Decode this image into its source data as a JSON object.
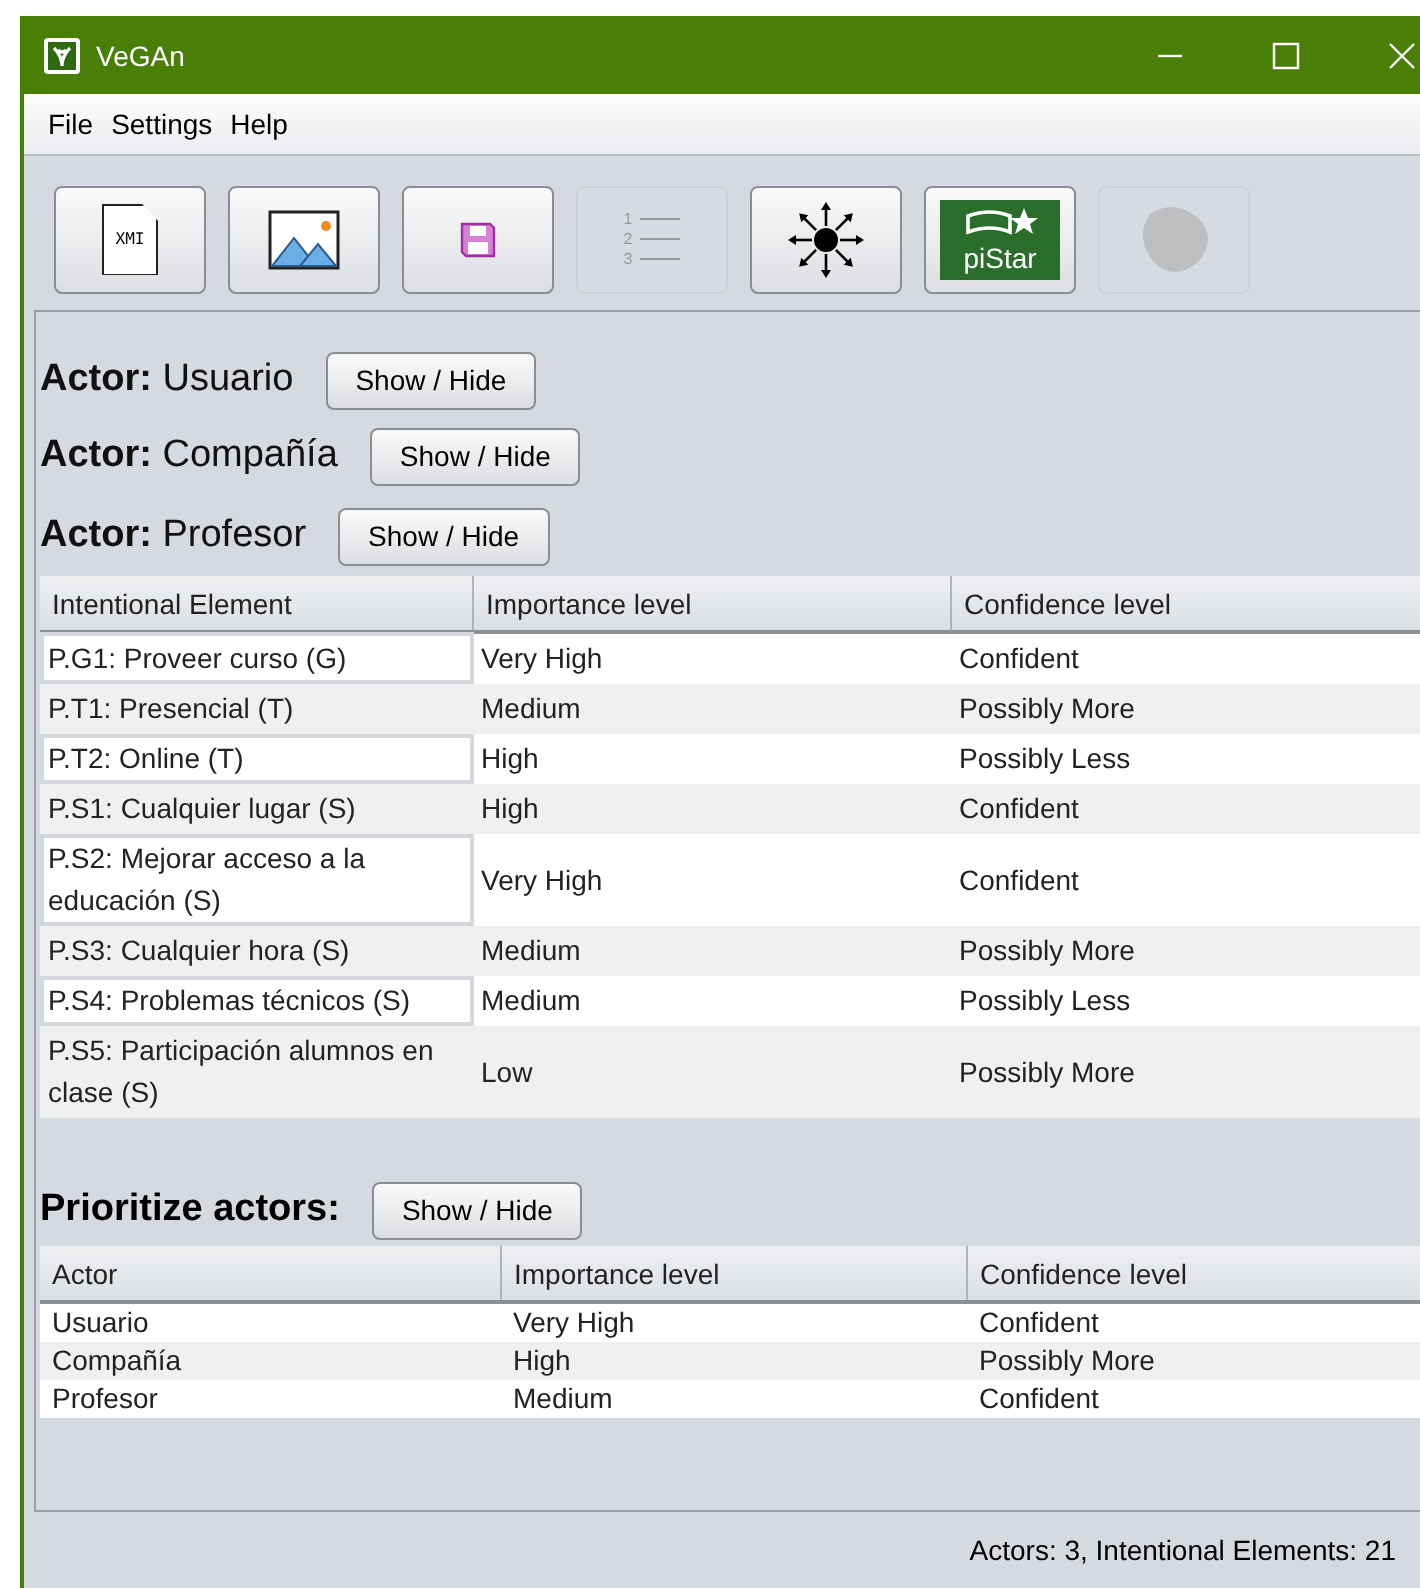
{
  "window": {
    "title": "VeGAn"
  },
  "menu": [
    "File",
    "Settings",
    "Help"
  ],
  "toolbar": [
    {
      "kind": "xmi",
      "disabled": false,
      "label": "XMI"
    },
    {
      "kind": "image",
      "disabled": false
    },
    {
      "kind": "save",
      "disabled": false
    },
    {
      "kind": "list",
      "disabled": true,
      "label": [
        "1",
        "2",
        "3"
      ]
    },
    {
      "kind": "spread",
      "disabled": false
    },
    {
      "kind": "pistar",
      "disabled": false,
      "label": "piStar"
    },
    {
      "kind": "blob",
      "disabled": true
    }
  ],
  "actors": [
    {
      "prefix": "Actor:",
      "name": "Usuario",
      "button": "Show / Hide"
    },
    {
      "prefix": "Actor:",
      "name": "Compañía",
      "button": "Show / Hide"
    },
    {
      "prefix": "Actor:",
      "name": "Profesor",
      "button": "Show / Hide"
    }
  ],
  "elements_table": {
    "columns": [
      "Intentional Element",
      "Importance level",
      "Confidence level"
    ],
    "rows": [
      [
        "P.G1: Proveer curso (G)",
        "Very High",
        "Confident"
      ],
      [
        "P.T1: Presencial (T)",
        "Medium",
        "Possibly More"
      ],
      [
        "P.T2: Online (T)",
        "High",
        "Possibly Less"
      ],
      [
        "P.S1: Cualquier lugar (S)",
        "High",
        "Confident"
      ],
      [
        "P.S2: Mejorar acceso a la educación (S)",
        "Very High",
        "Confident"
      ],
      [
        "P.S3: Cualquier hora (S)",
        "Medium",
        "Possibly More"
      ],
      [
        "P.S4: Problemas técnicos (S)",
        "Medium",
        "Possibly Less"
      ],
      [
        "P.S5: Participación alumnos en clase (S)",
        "Low",
        "Possibly More"
      ]
    ]
  },
  "prioritize": {
    "title": "Prioritize actors:",
    "button": "Show / Hide",
    "columns": [
      "Actor",
      "Importance level",
      "Confidence level"
    ],
    "rows": [
      [
        "Usuario",
        "Very High",
        "Confident"
      ],
      [
        "Compañía",
        "High",
        "Possibly More"
      ],
      [
        "Profesor",
        "Medium",
        "Confident"
      ]
    ]
  },
  "status_bar": "Actors: 3, Intentional Elements: 21"
}
